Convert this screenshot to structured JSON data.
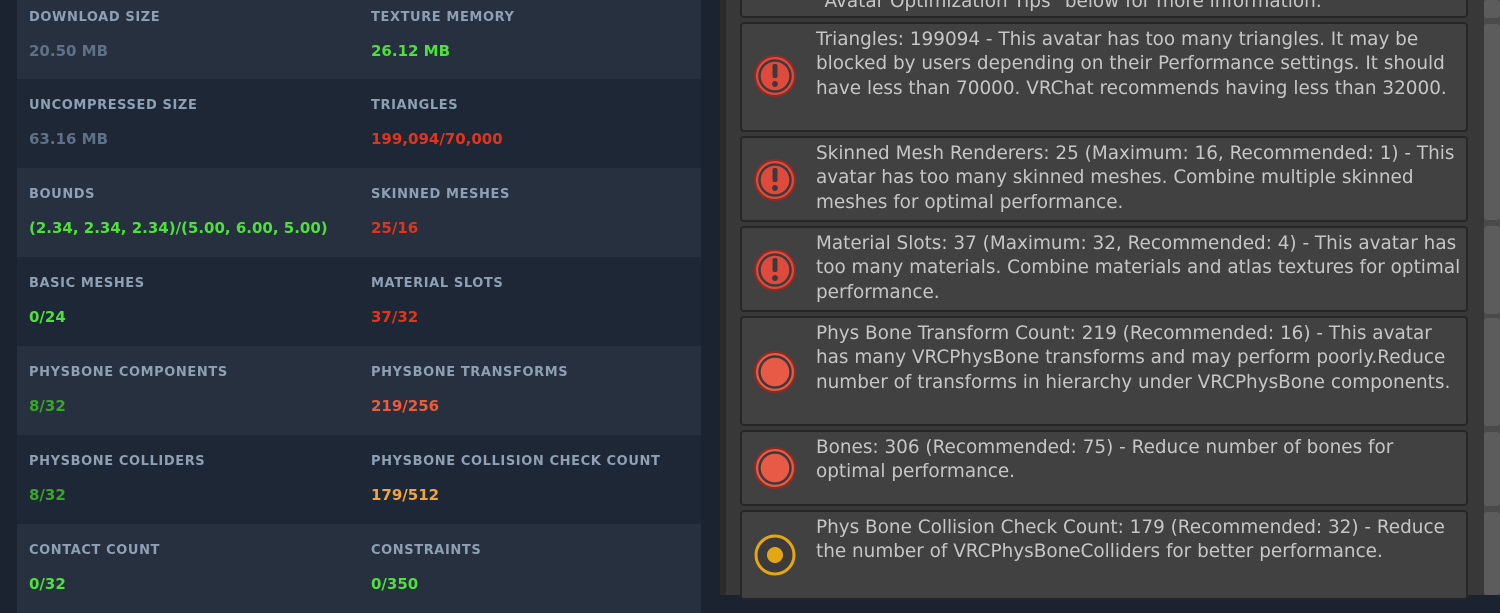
{
  "stats": [
    {
      "left": {
        "label": "DOWNLOAD SIZE",
        "value": "20.50 MB",
        "color": "grey"
      },
      "right": {
        "label": "TEXTURE MEMORY",
        "value": "26.12 MB",
        "color": "green"
      }
    },
    {
      "left": {
        "label": "UNCOMPRESSED SIZE",
        "value": "63.16 MB",
        "color": "grey"
      },
      "right": {
        "label": "TRIANGLES",
        "value": "199,094/70,000",
        "color": "red"
      }
    },
    {
      "left": {
        "label": "BOUNDS",
        "value": "(2.34, 2.34, 2.34)/(5.00, 6.00, 5.00)",
        "color": "green"
      },
      "right": {
        "label": "SKINNED MESHES",
        "value": "25/16",
        "color": "red"
      }
    },
    {
      "left": {
        "label": "BASIC MESHES",
        "value": "0/24",
        "color": "green"
      },
      "right": {
        "label": "MATERIAL SLOTS",
        "value": "37/32",
        "color": "red"
      }
    },
    {
      "left": {
        "label": "PHYSBONE COMPONENTS",
        "value": "8/32",
        "color": "dkgreen"
      },
      "right": {
        "label": "PHYSBONE TRANSFORMS",
        "value": "219/256",
        "color": "orange"
      }
    },
    {
      "left": {
        "label": "PHYSBONE COLLIDERS",
        "value": "8/32",
        "color": "dkgreen"
      },
      "right": {
        "label": "PHYSBONE COLLISION CHECK COUNT",
        "value": "179/512",
        "color": "yellow"
      }
    },
    {
      "left": {
        "label": "CONTACT COUNT",
        "value": "0/32",
        "color": "green"
      },
      "right": {
        "label": "CONSTRAINTS",
        "value": "0/350",
        "color": "green"
      }
    }
  ],
  "messages": {
    "top_partial": "\"Avatar Optimization Tips\" below for more information.",
    "triangles": "Triangles: 199094 - This avatar has too many triangles. It may be blocked by users depending on their Performance settings. It should have less than 70000. VRChat recommends having less than 32000.",
    "skinned": "Skinned Mesh Renderers: 25 (Maximum: 16, Recommended: 1) - This avatar has too many skinned meshes. Combine multiple skinned meshes for optimal performance.",
    "material": "Material Slots: 37 (Maximum: 32, Recommended: 4) - This avatar has too many materials. Combine materials and atlas textures for optimal performance.",
    "physbone_transforms": "Phys Bone Transform Count: 219 (Recommended: 16) - This avatar has many VRCPhysBone transforms and may perform poorly.Reduce number of transforms in hierarchy under VRCPhysBone components.",
    "bones": "Bones: 306 (Recommended: 75) - Reduce number of bones for optimal performance.",
    "collision": "Phys Bone Collision Check Count: 179 (Recommended: 32) - Reduce the number of VRCPhysBoneColliders for better performance."
  },
  "icons": {
    "error": "error-exclamation-icon",
    "warning": "warning-circle-icon",
    "info": "info-dot-icon"
  },
  "colors": {
    "error": "#e04a3c",
    "warning": "#e85a46",
    "info": "#e5a614",
    "green": "#4ee03c",
    "red": "#e3341b"
  }
}
